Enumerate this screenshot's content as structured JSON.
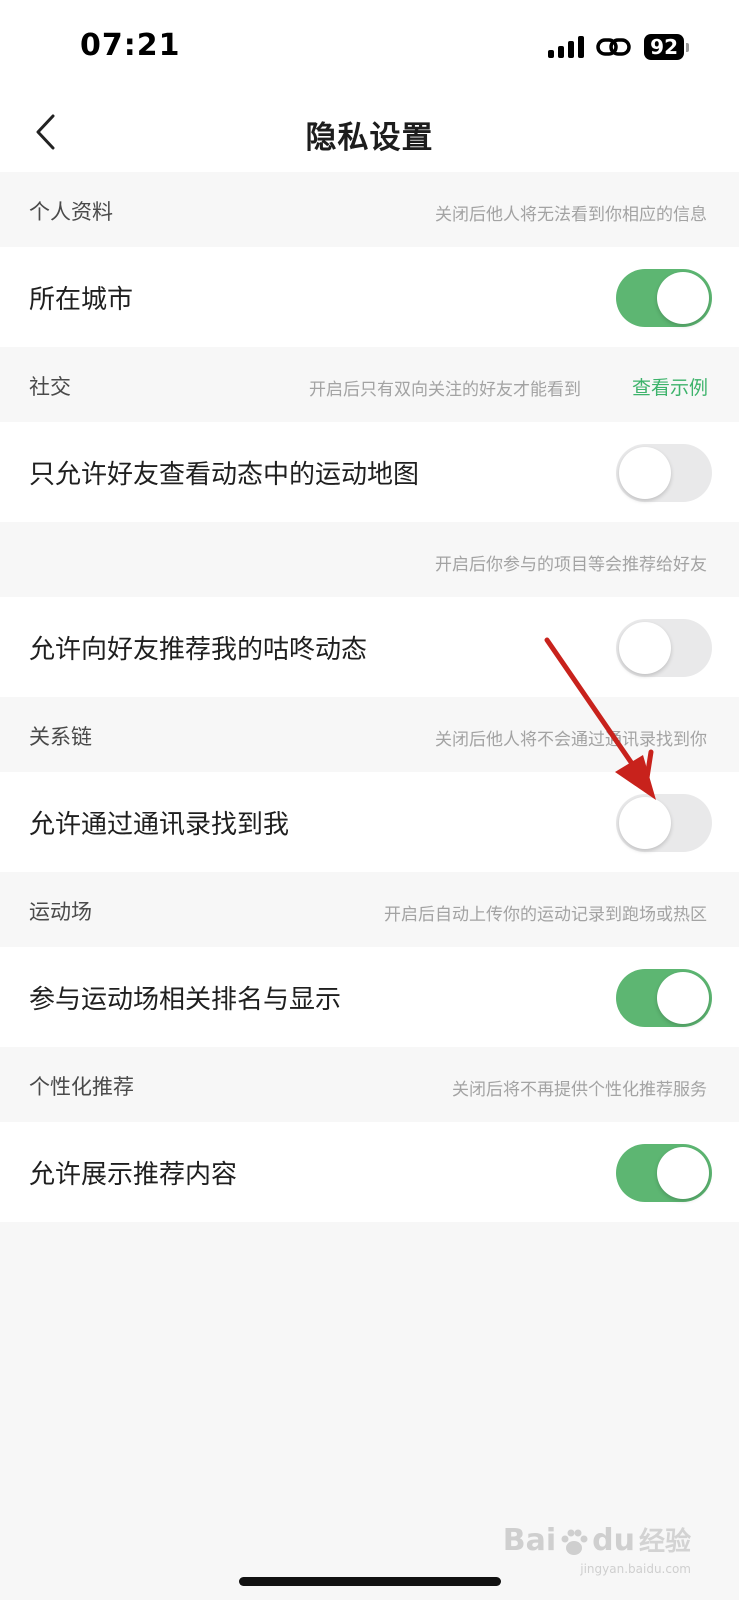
{
  "status_bar": {
    "time": "07:21",
    "battery": "92"
  },
  "nav": {
    "title": "隐私设置"
  },
  "sections": [
    {
      "title": "个人资料",
      "note": "关闭后他人将无法看到你相应的信息"
    },
    {
      "title": "社交",
      "note": "开启后只有双向关注的好友才能看到",
      "link": "查看示例"
    },
    {
      "title": "",
      "note": "开启后你参与的项目等会推荐给好友"
    },
    {
      "title": "关系链",
      "note": "关闭后他人将不会通过通讯录找到你"
    },
    {
      "title": "运动场",
      "note": "开启后自动上传你的运动记录到跑场或热区"
    },
    {
      "title": "个性化推荐",
      "note": "关闭后将不再提供个性化推荐服务"
    }
  ],
  "rows": [
    {
      "label": "所在城市",
      "on": true
    },
    {
      "label": "只允许好友查看动态中的运动地图",
      "on": false
    },
    {
      "label": "允许向好友推荐我的咕咚动态",
      "on": false
    },
    {
      "label": "允许通过通讯录找到我",
      "on": false
    },
    {
      "label": "参与运动场相关排名与显示",
      "on": true
    },
    {
      "label": "允许展示推荐内容",
      "on": true
    }
  ],
  "colors": {
    "toggle_on": "#5db672",
    "toggle_off": "#e9e9ea",
    "link": "#3db36b",
    "arrow": "#c8221c"
  },
  "watermark": {
    "brand": "Bai",
    "brand_tail": "du",
    "cn": "经验",
    "sub": "jingyan.baidu.com"
  }
}
